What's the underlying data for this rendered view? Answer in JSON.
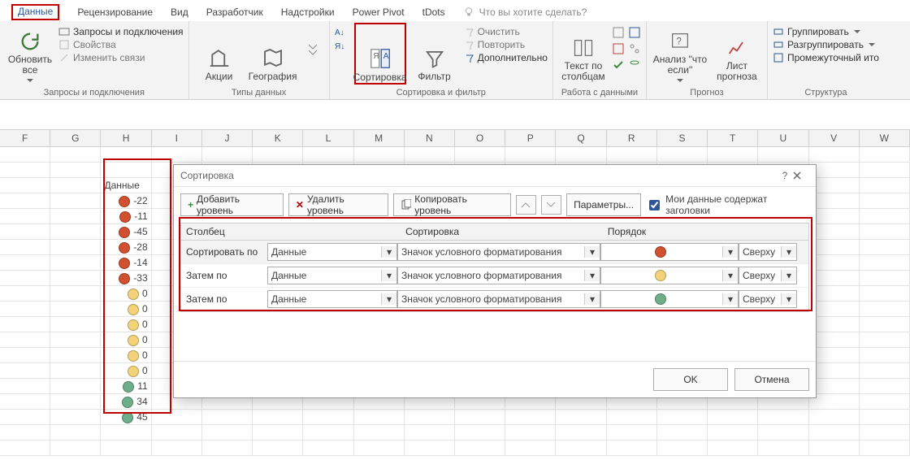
{
  "tabs": {
    "active": "Данные",
    "items": [
      "Данные",
      "Рецензирование",
      "Вид",
      "Разработчик",
      "Надстройки",
      "Power Pivot",
      "tDots"
    ],
    "tellme": "Что вы хотите сделать?"
  },
  "ribbon": {
    "g1": {
      "label": "Запросы и подключения",
      "refresh": "Обновить все",
      "links": [
        "Запросы и подключения",
        "Свойства",
        "Изменить связи"
      ]
    },
    "g2": {
      "label": "Типы данных",
      "a": "Акции",
      "b": "География"
    },
    "g3": {
      "label": "Сортировка и фильтр",
      "sort": "Сортировка",
      "filter": "Фильтр",
      "clear": "Очистить",
      "reapply": "Повторить",
      "adv": "Дополнительно"
    },
    "g4": {
      "label": "Работа с данными",
      "ttc": "Текст по столбцам"
    },
    "g5": {
      "label": "Прогноз",
      "whatif": "Анализ \"что если\"",
      "forecast": "Лист прогноза"
    },
    "g6": {
      "label": "Структура",
      "grp": "Группировать",
      "ungrp": "Разгруппировать",
      "sub": "Промежуточный ито"
    }
  },
  "cols": [
    "F",
    "G",
    "H",
    "I",
    "J",
    "K",
    "L",
    "M",
    "N",
    "O",
    "P",
    "Q",
    "R",
    "S",
    "T",
    "U",
    "V",
    "W"
  ],
  "table": {
    "header": "Данные",
    "rows": [
      {
        "c": "red",
        "v": -22
      },
      {
        "c": "red",
        "v": -11
      },
      {
        "c": "red",
        "v": -45
      },
      {
        "c": "red",
        "v": -28
      },
      {
        "c": "red",
        "v": -14
      },
      {
        "c": "red",
        "v": -33
      },
      {
        "c": "ylw",
        "v": 0
      },
      {
        "c": "ylw",
        "v": 0
      },
      {
        "c": "ylw",
        "v": 0
      },
      {
        "c": "ylw",
        "v": 0
      },
      {
        "c": "ylw",
        "v": 0
      },
      {
        "c": "ylw",
        "v": 0
      },
      {
        "c": "grn",
        "v": 11
      },
      {
        "c": "grn",
        "v": 34
      },
      {
        "c": "grn",
        "v": 45
      }
    ]
  },
  "dlg": {
    "title": "Сортировка",
    "add": "Добавить уровень",
    "del": "Удалить уровень",
    "copy": "Копировать уровень",
    "opts": "Параметры...",
    "myhdr": "Мои данные содержат заголовки",
    "h": {
      "col": "Столбец",
      "sort": "Сортировка",
      "order": "Порядок"
    },
    "ok": "OK",
    "cancel": "Отмена",
    "rows": [
      {
        "label": "Сортировать по",
        "col": "Данные",
        "sort": "Значок условного форматирования",
        "icon": "red",
        "dir": "Сверху"
      },
      {
        "label": "Затем по",
        "col": "Данные",
        "sort": "Значок условного форматирования",
        "icon": "ylw",
        "dir": "Сверху"
      },
      {
        "label": "Затем по",
        "col": "Данные",
        "sort": "Значок условного форматирования",
        "icon": "grn",
        "dir": "Сверху"
      }
    ]
  }
}
